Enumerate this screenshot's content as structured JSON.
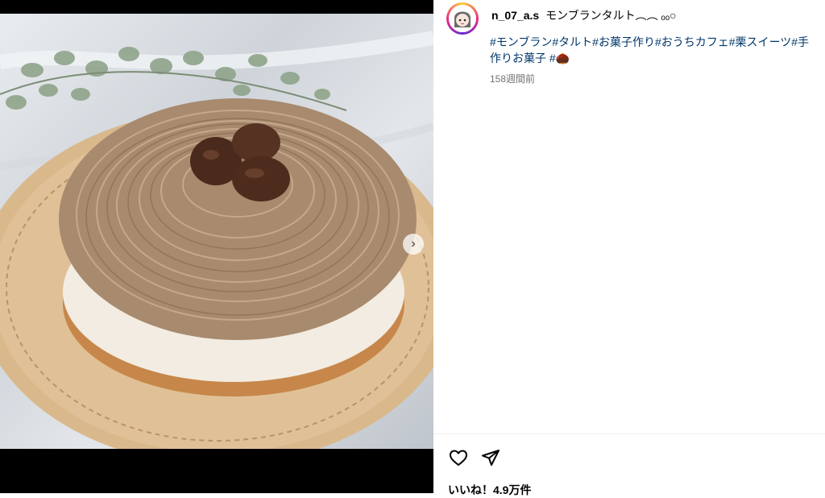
{
  "post": {
    "image_alt": "Mont Blanc tart on a wooden plate",
    "username": "n_07_a.s",
    "title": "モンブランタルト︵︵ ₒₒ○",
    "hashtags_line1": "#モンブラン#タルト#お菓子作り#おうちカフェ#栗スイーツ#手",
    "hashtags_line2": "作りお菓子 #🌰",
    "time_ago": "158週間前",
    "likes": "いいね！4.9万件"
  },
  "icons": {
    "like": "heart-icon",
    "share": "send-icon",
    "next": "chevron-right-icon"
  }
}
